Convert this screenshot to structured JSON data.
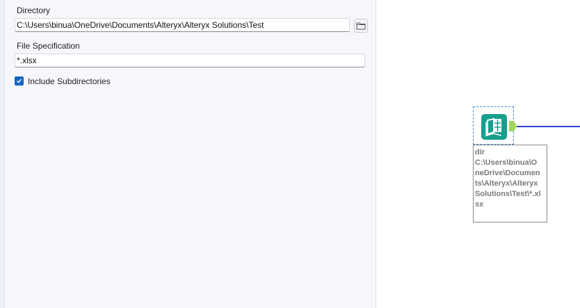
{
  "config": {
    "directory_label": "Directory",
    "directory_value": "C:\\Users\\binua\\OneDrive\\Documents\\Alteryx\\Alteryx Solutions\\Test",
    "file_spec_label": "File Specification",
    "file_spec_value": "*.xlsx",
    "include_subdirs_label": "Include Subdirectories",
    "include_subdirs_checked": true,
    "browse_icon": "folder-icon"
  },
  "canvas": {
    "tool_icon": "directory-book-icon",
    "annotation_lines": [
      "dir",
      "C:\\Users\\binua\\O",
      "neDrive\\Documen",
      "ts\\Alteryx\\Alteryx",
      "Solutions\\Test\\*.xl",
      "sx"
    ],
    "colors": {
      "tool": "#16a08c",
      "anchor": "#a6d35a",
      "wire": "#3540d8"
    }
  }
}
